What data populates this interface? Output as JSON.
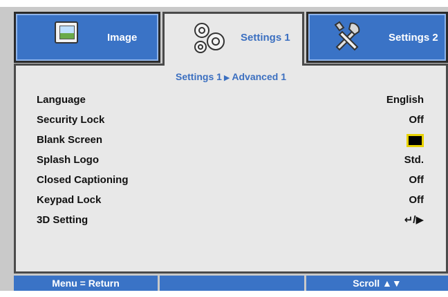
{
  "tabs": [
    {
      "label": "Image",
      "icon": "image-icon"
    },
    {
      "label": "Settings 1",
      "icon": "gears-icon"
    },
    {
      "label": "Settings 2",
      "icon": "tools-icon"
    }
  ],
  "breadcrumb": {
    "parent": "Settings 1",
    "arrow": "▶",
    "current": "Advanced 1"
  },
  "menu": [
    {
      "label": "Language",
      "value": "English"
    },
    {
      "label": "Security Lock",
      "value": "Off"
    },
    {
      "label": "Blank Screen",
      "value": ""
    },
    {
      "label": "Splash Logo",
      "value": "Std."
    },
    {
      "label": "Closed Captioning",
      "value": "Off"
    },
    {
      "label": "Keypad Lock",
      "value": "Off"
    },
    {
      "label": "3D Setting",
      "value": "↵/▶"
    }
  ],
  "footer": {
    "left": "Menu = Return",
    "middle": "",
    "right": "Scroll ▲▼"
  },
  "colors": {
    "accent": "#3a73c6",
    "active_text": "#3b6fc0",
    "panel_bg": "#e8e8e8",
    "highlight_border": "#e8d200"
  }
}
